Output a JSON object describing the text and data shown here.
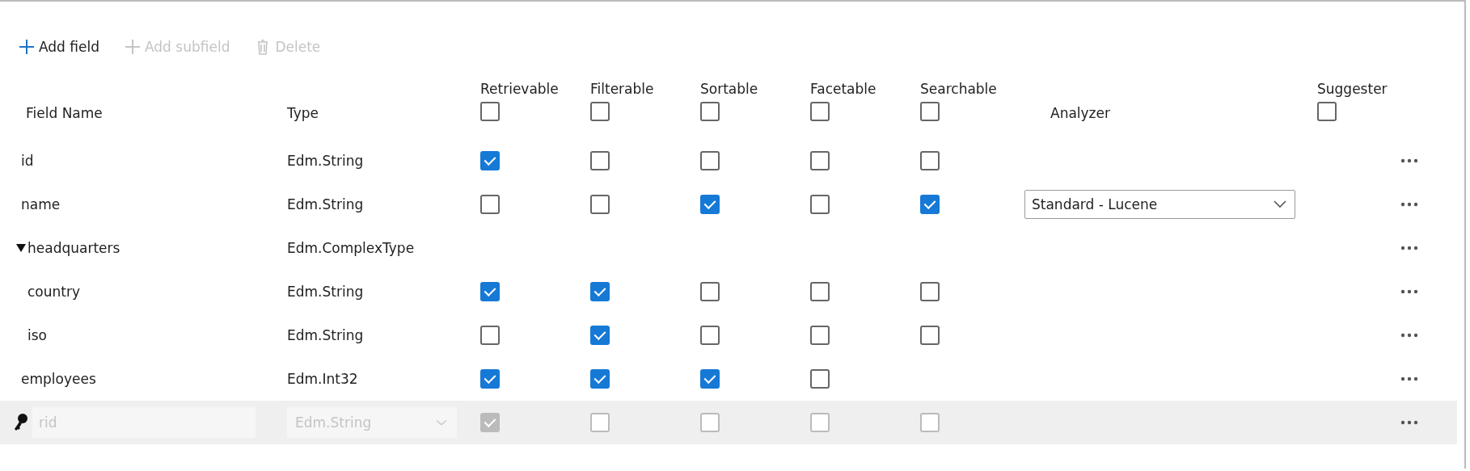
{
  "toolbar": [
    {
      "label": "Add field",
      "disabled": false
    },
    {
      "label": "Add subfield",
      "disabled": true
    },
    {
      "label": "Delete",
      "disabled": true
    }
  ],
  "columns": {
    "field_name": "Field Name",
    "type": "Type",
    "analyzer": "Analyzer"
  },
  "flag_columns": [
    {
      "label": "Retrievable",
      "checked": false
    },
    {
      "label": "Filterable",
      "checked": false
    },
    {
      "label": "Sortable",
      "checked": false
    },
    {
      "label": "Facetable",
      "checked": false
    },
    {
      "label": "Searchable",
      "checked": false
    }
  ],
  "suggester": {
    "label": "Suggester",
    "checked": false
  },
  "rows": [
    {
      "kind": "field",
      "name": "id",
      "type": "Edm.String",
      "flags": [
        true,
        false,
        false,
        false,
        false
      ]
    },
    {
      "kind": "field",
      "name": "name",
      "type": "Edm.String",
      "flags": [
        false,
        false,
        true,
        false,
        true
      ],
      "analyzer": "Standard - Lucene"
    },
    {
      "kind": "field",
      "name": "headquarters",
      "type": "Edm.ComplexType",
      "expanded": true,
      "children": [
        {
          "kind": "field",
          "name": "country",
          "type": "Edm.String",
          "flags": [
            true,
            true,
            false,
            false,
            false
          ]
        },
        {
          "kind": "field",
          "name": "iso",
          "type": "Edm.String",
          "flags": [
            false,
            true,
            false,
            false,
            false
          ]
        }
      ]
    },
    {
      "kind": "field",
      "name": "employees",
      "type": "Edm.Int32",
      "flags": [
        true,
        true,
        true,
        false
      ]
    },
    {
      "kind": "new",
      "placeholder": "rid",
      "type": "Edm.String",
      "disabled": true,
      "flags": [
        true,
        false,
        false,
        false,
        false
      ]
    }
  ]
}
